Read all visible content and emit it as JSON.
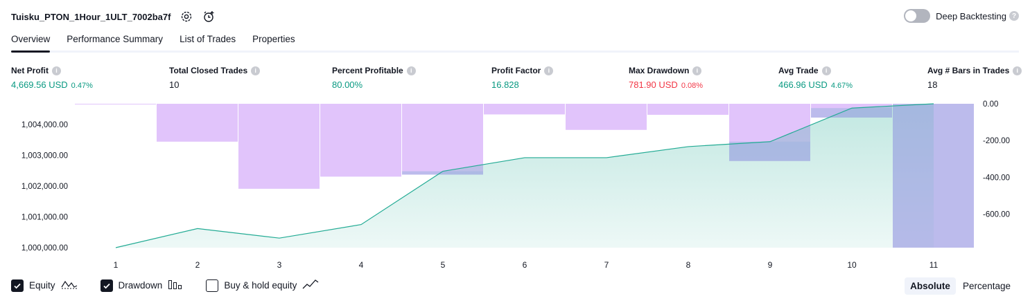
{
  "header": {
    "strategy_name": "Tuisku_PTON_1Hour_1ULT_7002ba7f",
    "deep_backtesting_label": "Deep Backtesting",
    "help_glyph": "?"
  },
  "tabs": [
    {
      "label": "Overview",
      "active": true
    },
    {
      "label": "Performance Summary",
      "active": false
    },
    {
      "label": "List of Trades",
      "active": false
    },
    {
      "label": "Properties",
      "active": false
    }
  ],
  "metrics": [
    {
      "label": "Net Profit",
      "value": "4,669.56 USD",
      "pct": "0.47%",
      "color": "green"
    },
    {
      "label": "Total Closed Trades",
      "value": "10",
      "pct": "",
      "color": "dark"
    },
    {
      "label": "Percent Profitable",
      "value": "80.00%",
      "pct": "",
      "color": "green"
    },
    {
      "label": "Profit Factor",
      "value": "16.828",
      "pct": "",
      "color": "green"
    },
    {
      "label": "Max Drawdown",
      "value": "781.90 USD",
      "pct": "0.08%",
      "color": "red"
    },
    {
      "label": "Avg Trade",
      "value": "466.96 USD",
      "pct": "4.67%",
      "color": "green"
    },
    {
      "label": "Avg # Bars in Trades",
      "value": "18",
      "pct": "",
      "color": "dark"
    }
  ],
  "chart_data": {
    "type": "line",
    "categories": [
      "1",
      "2",
      "3",
      "4",
      "5",
      "6",
      "7",
      "8",
      "9",
      "10",
      "11"
    ],
    "series": [
      {
        "name": "Equity",
        "axis": "left",
        "kind": "area-line",
        "color": "#22ab94",
        "values": [
          1000000,
          1000620,
          1000310,
          1000750,
          1002480,
          1002920,
          1002920,
          1003280,
          1003440,
          1004530,
          1004670
        ]
      },
      {
        "name": "Drawdown",
        "axis": "right",
        "kind": "bar",
        "color": "#ce93d8",
        "values": [
          0,
          -206,
          -462,
          -396,
          -385,
          -58,
          -142,
          -60,
          -311,
          -75,
          -781.9
        ]
      }
    ],
    "left_axis": {
      "ticks": [
        "1,000,000.00",
        "1,001,000.00",
        "1,002,000.00",
        "1,003,000.00",
        "1,004,000.00"
      ],
      "range": [
        1000000,
        1004670
      ]
    },
    "right_axis": {
      "ticks": [
        "0.00",
        "-200.00",
        "-400.00",
        "-600.00"
      ],
      "range": [
        -781.9,
        0
      ]
    }
  },
  "footer": {
    "toggles": [
      {
        "label": "Equity",
        "checked": true,
        "icon": "equity-line-icon"
      },
      {
        "label": "Drawdown",
        "checked": true,
        "icon": "drawdown-bars-icon"
      },
      {
        "label": "Buy & hold equity",
        "checked": false,
        "icon": "buy-hold-line-icon"
      }
    ],
    "modes": [
      {
        "label": "Absolute",
        "active": true
      },
      {
        "label": "Percentage",
        "active": false
      }
    ]
  }
}
